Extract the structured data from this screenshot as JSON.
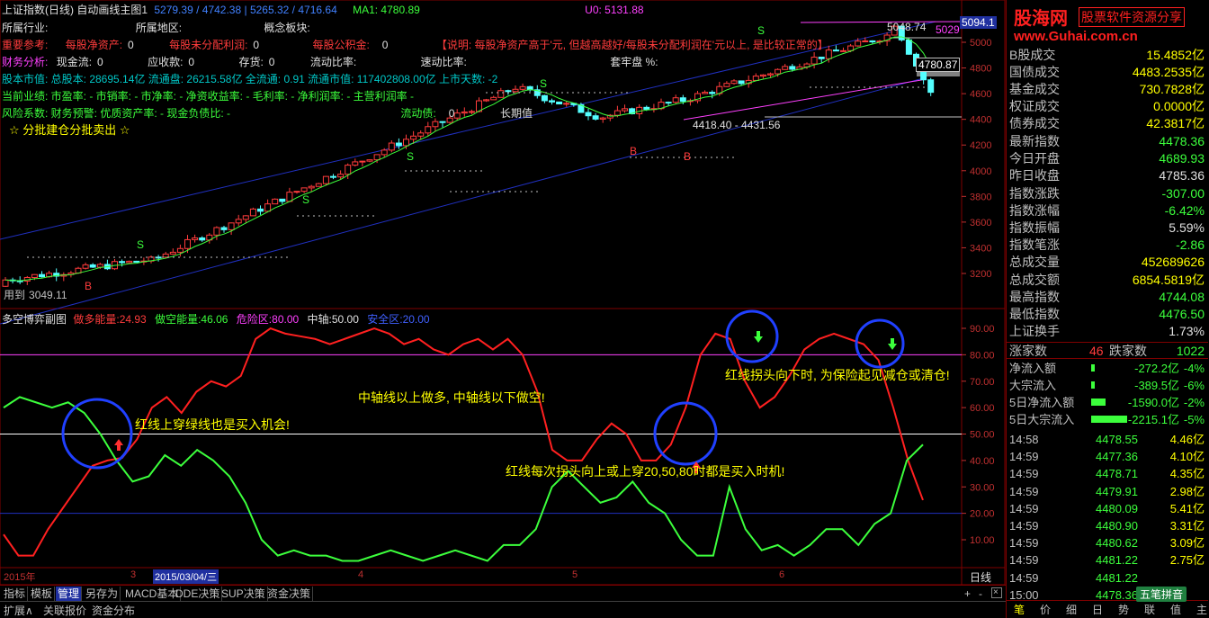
{
  "header": {
    "title": "上证指数(日线) 自动画线主图1",
    "ma_vals": [
      "5279.39",
      "4742.38",
      "5265.32",
      "4716.64"
    ],
    "ma1": "MA1: 4780.89",
    "u0": "U0: 5131.88"
  },
  "info": {
    "industry": "所属行业:",
    "region": "所属地区:",
    "concept": "概念板块:",
    "ref_label": "重要参考:",
    "eps_label": "每股净资产:",
    "eps_val": "0",
    "undist_label": "每股未分配利润:",
    "undist_val": "0",
    "reserve_label": "每股公积金:",
    "reserve_val": "0",
    "note": "【说明: 每股净资产高于'元, 但越高越好/每股未分配利润在'元以上, 是比较正常的】",
    "fin_label": "财务分析:",
    "cash_label": "现金流:",
    "cash_val": "0",
    "recv_label": "应收款:",
    "recv_val": "0",
    "inv_label": "存货:",
    "inv_val": "0",
    "cur_ratio": "流动比率:",
    "quick_ratio": "速动比率:",
    "lock_ratio": "套牢盘 %:",
    "equity_line": "股本市值: 总股本: 28695.14亿 流通盘: 26215.58亿 全流通: 0.91 流通市值: 117402808.00亿 上市天数: -2",
    "industry_line": "当前业绩: 市盈率: - 市销率: - 市净率: - 净资收益率: - 毛利率: - 净利润率: - 主营利润率 -",
    "risk_line": "风险系数: 财务预警: 优质资产率: - 现金负债比: -",
    "flow_debt": "流动债:",
    "flow_debt_val": "0",
    "star_line": "☆ 分批建仓分批卖出 ☆"
  },
  "price_axis": [
    "5000",
    "4800",
    "4600",
    "4400",
    "4200",
    "4000",
    "3800",
    "3600",
    "3400",
    "3200"
  ],
  "price_labels": {
    "top_box": "5094.1",
    "right_box": "4780.87",
    "low_note": "4418.40 - 4431.56",
    "mid_note": "5048.74",
    "left_low": "3049.11",
    "use_label": "用到",
    "long_label": "长期值",
    "top_right": "5029"
  },
  "signals": {
    "S": "S",
    "B": "B"
  },
  "sub": {
    "title": "多空博弈副图",
    "bull_label": "做多能量:",
    "bull_val": "24.93",
    "bear_label": "做空能量:",
    "bear_val": "46.06",
    "danger_label": "危险区:",
    "danger_val": "80.00",
    "mid_label": "中轴:",
    "mid_val": "50.00",
    "safe_label": "安全区:",
    "safe_val": "20.00",
    "axis": [
      "90.00",
      "80.00",
      "70.00",
      "60.00",
      "50.00",
      "40.00",
      "30.00",
      "20.00",
      "10.00"
    ],
    "annotations": [
      "中轴线以上做多, 中轴线以下做空!",
      "红线上穿绿线也是买入机会!",
      "红线每次拐头向上或上穿20,50,80时都是买入时机!",
      "红线拐头向下时, 为保险起见减仓或清仓!"
    ]
  },
  "dates": {
    "d1": "2015年",
    "d2": "3",
    "d3": "2015/03/04/三",
    "d4": "4",
    "d5": "5",
    "d6": "6"
  },
  "tabs": [
    "指标",
    "模板",
    "管理",
    "另存为",
    "MACD基本",
    "DDE决策",
    "SUP决策",
    "资金决策"
  ],
  "tab_right": "日线",
  "status": [
    "扩展∧",
    "关联报价",
    "资金分布"
  ],
  "right": {
    "logo_main": "股海网",
    "logo_sub": "股票软件资源分享",
    "logo_url": "www.Guhai.com.cn",
    "rows1": [
      {
        "label": "B股成交",
        "value": "15.4852亿",
        "color": "#ffff00"
      },
      {
        "label": "国债成交",
        "value": "4483.2535亿",
        "color": "#ffff00"
      },
      {
        "label": "基金成交",
        "value": "730.7828亿",
        "color": "#ffff00"
      },
      {
        "label": "权证成交",
        "value": "0.0000亿",
        "color": "#ffff00"
      },
      {
        "label": "债券成交",
        "value": "42.3817亿",
        "color": "#ffff00"
      }
    ],
    "rows2": [
      {
        "label": "最新指数",
        "value": "4478.36",
        "color": "#3cff3c"
      },
      {
        "label": "今日开盘",
        "value": "4689.93",
        "color": "#3cff3c"
      },
      {
        "label": "昨日收盘",
        "value": "4785.36",
        "color": "#e0e0e0"
      },
      {
        "label": "指数涨跌",
        "value": "-307.00",
        "color": "#3cff3c"
      },
      {
        "label": "指数涨幅",
        "value": "-6.42%",
        "color": "#3cff3c"
      },
      {
        "label": "指数振幅",
        "value": "5.59%",
        "color": "#e0e0e0"
      },
      {
        "label": "指数笔涨",
        "value": "-2.86",
        "color": "#3cff3c"
      },
      {
        "label": "总成交量",
        "value": "452689626",
        "color": "#ffff00"
      },
      {
        "label": "总成交额",
        "value": "6854.5819亿",
        "color": "#ffff00"
      },
      {
        "label": "最高指数",
        "value": "4744.08",
        "color": "#3cff3c"
      },
      {
        "label": "最低指数",
        "value": "4476.50",
        "color": "#3cff3c"
      },
      {
        "label": "上证换手",
        "value": "1.73%",
        "color": "#e0e0e0"
      }
    ],
    "updown": {
      "up_label": "涨家数",
      "up_val": "46",
      "down_label": "跌家数",
      "down_val": "1022"
    },
    "flows": [
      {
        "label": "净流入额",
        "value": "-272.2亿",
        "pct": "-4%"
      },
      {
        "label": "大宗流入",
        "value": "-389.5亿",
        "pct": "-6%"
      },
      {
        "label": "5日净流入额",
        "value": "-1590.0亿",
        "pct": "-2%"
      },
      {
        "label": "5日大宗流入",
        "value": "-2215.1亿",
        "pct": "-5%"
      }
    ],
    "ticks": [
      {
        "t": "14:58",
        "p": "4478.55",
        "v": "4.46亿"
      },
      {
        "t": "14:59",
        "p": "4477.36",
        "v": "4.10亿"
      },
      {
        "t": "14:59",
        "p": "4478.71",
        "v": "4.35亿"
      },
      {
        "t": "14:59",
        "p": "4479.91",
        "v": "2.98亿"
      },
      {
        "t": "14:59",
        "p": "4480.09",
        "v": "5.41亿"
      },
      {
        "t": "14:59",
        "p": "4480.90",
        "v": "3.31亿"
      },
      {
        "t": "14:59",
        "p": "4480.62",
        "v": "3.09亿"
      },
      {
        "t": "14:59",
        "p": "4481.22",
        "v": "2.75亿"
      },
      {
        "t": "14:59",
        "p": "4481.22",
        "v": ""
      },
      {
        "t": "15:00",
        "p": "4478.36",
        "v": ""
      }
    ],
    "bottom_tabs": [
      "笔",
      "价",
      "细",
      "日",
      "势",
      "联",
      "值",
      "主"
    ],
    "ime": "五笔拼音"
  }
}
